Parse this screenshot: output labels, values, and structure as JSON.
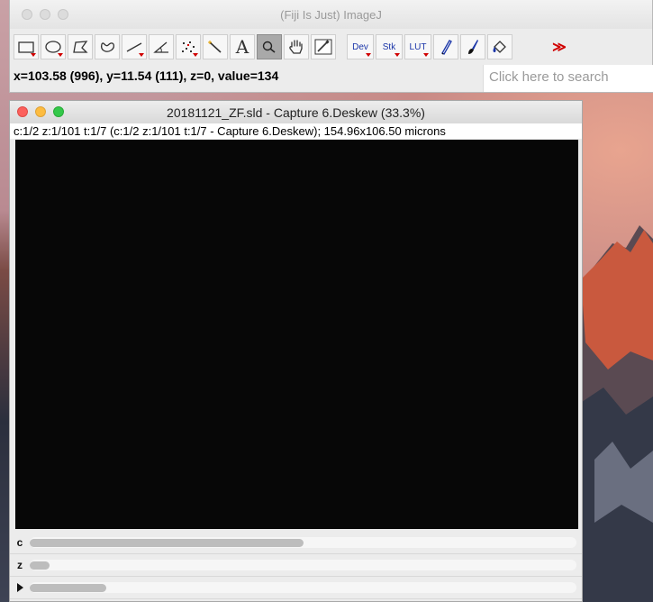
{
  "fiji": {
    "window_title": "(Fiji Is Just) ImageJ",
    "status_text": "x=103.58 (996), y=11.54 (111), z=0, value=134",
    "search_placeholder": "Click here to search",
    "more_label": "≫",
    "tools": [
      {
        "name": "rectangle-tool",
        "icon": "rectangle-icon"
      },
      {
        "name": "oval-tool",
        "icon": "oval-icon"
      },
      {
        "name": "polygon-tool",
        "icon": "polygon-icon"
      },
      {
        "name": "freehand-tool",
        "icon": "freehand-icon"
      },
      {
        "name": "line-tool",
        "icon": "line-icon"
      },
      {
        "name": "angle-tool",
        "icon": "angle-icon"
      },
      {
        "name": "point-tool",
        "icon": "multipoint-icon"
      },
      {
        "name": "wand-tool",
        "icon": "wand-icon"
      },
      {
        "name": "text-tool",
        "icon": "text-A-icon",
        "glyph": "A"
      },
      {
        "name": "magnifier-tool",
        "icon": "magnifier-icon",
        "selected": true
      },
      {
        "name": "hand-tool",
        "icon": "hand-icon"
      },
      {
        "name": "color-picker-tool",
        "icon": "dropper-icon"
      },
      {
        "name": "dev-tool",
        "label": "Dev"
      },
      {
        "name": "stk-tool",
        "label": "Stk"
      },
      {
        "name": "lut-tool",
        "label": "LUT"
      },
      {
        "name": "pencil-tool",
        "icon": "pencil-icon"
      },
      {
        "name": "brush-tool",
        "icon": "brush-icon"
      },
      {
        "name": "flood-fill-tool",
        "icon": "bucket-icon"
      }
    ]
  },
  "image_window": {
    "title": "20181121_ZF.sld - Capture 6.Deskew (33.3%)",
    "info": "c:1/2 z:1/101 t:1/7 (c:1/2 z:1/101 t:1/7 - Capture 6.Deskew); 154.96x106.50 microns",
    "sliders": [
      {
        "label": "c",
        "value": 0.5
      },
      {
        "label": "z",
        "value": 0.01
      },
      {
        "label": "",
        "value": 0.14
      }
    ]
  },
  "colors": {
    "close": "#fc605c",
    "minimize": "#fdbc40",
    "zoom": "#34c84a",
    "accent_red": "#d00000",
    "tool_text_blue": "#1a35a8"
  }
}
